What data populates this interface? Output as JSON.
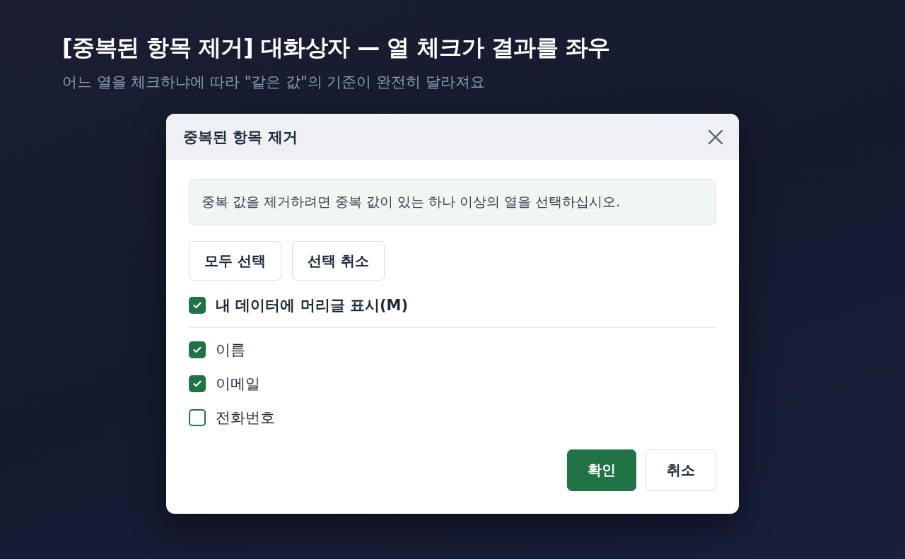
{
  "page": {
    "title": "[중복된 항목 제거] 대화상자 — 열 체크가 결과를 좌우",
    "subtitle": "어느 열을 체크하냐에 따라 \"같은 값\"의 기준이 완전히 달라져요"
  },
  "dialog": {
    "title": "중복된 항목 제거",
    "message": "중복 값을 제거하려면 중복 값이 있는 하나 이상의 열을 선택하십시오.",
    "selection_buttons": [
      "모두 선택",
      "선택 취소"
    ],
    "header_option": {
      "label": "내 데이터에 머리글 표시(M)",
      "checked": true
    },
    "columns": [
      {
        "label": "이름",
        "checked": true
      },
      {
        "label": "이메일",
        "checked": true
      },
      {
        "label": "전화번호",
        "checked": false
      }
    ],
    "buttons": [
      {
        "label": "확인",
        "kind": "primary"
      },
      {
        "label": "취소",
        "kind": "secondary"
      }
    ]
  }
}
